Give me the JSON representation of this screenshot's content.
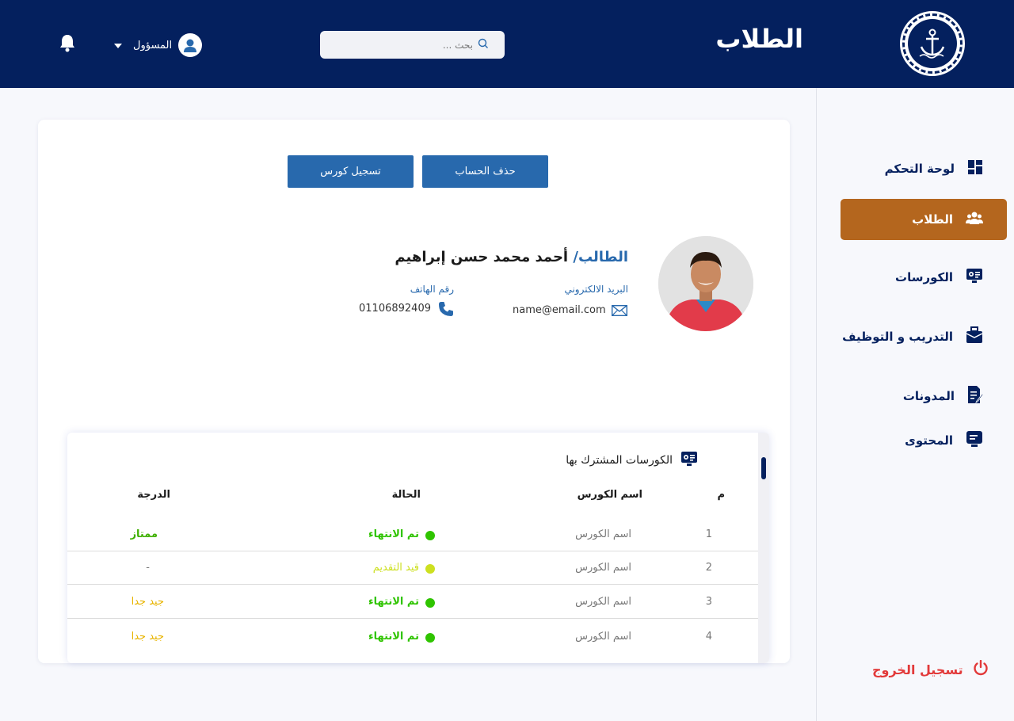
{
  "header": {
    "title": "الطلاب",
    "search_placeholder": "بحث ...",
    "user_label": "المسؤول"
  },
  "sidebar": {
    "items": [
      {
        "label": "لوحة التحكم",
        "icon": "dashboard-icon",
        "active": false
      },
      {
        "label": "الطلاب",
        "icon": "users-icon",
        "active": true
      },
      {
        "label": "الكورسات",
        "icon": "courses-icon",
        "active": false
      },
      {
        "label": "التدريب و التوظيف",
        "icon": "briefcase-icon",
        "active": false
      },
      {
        "label": "المدونات",
        "icon": "blog-edit-icon",
        "active": false
      },
      {
        "label": "المحتوى",
        "icon": "content-icon",
        "active": false
      }
    ],
    "logout_label": "تسجيل الخروج"
  },
  "actions": {
    "delete_account": "حذف الحساب",
    "register_course": "تسجيل كورس"
  },
  "student": {
    "name_prefix": "الطالب/",
    "name": "أحمد محمد حسن إبراهيم",
    "email_label": "البريد الالكتروني",
    "email": "name@email.com",
    "phone_label": "رقم الهاتف",
    "phone": "01106892409"
  },
  "courses": {
    "title": "الكورسات المشترك بها",
    "columns": {
      "num": "م",
      "name": "اسم الكورس",
      "status": "الحالة",
      "grade": "الدرجة"
    },
    "rows": [
      {
        "num": "1",
        "name": "اسم الكورس",
        "status": "تم الانتهاء",
        "grade": "ممتاز"
      },
      {
        "num": "2",
        "name": "اسم الكورس",
        "status": "قيد التقديم",
        "grade": "-"
      },
      {
        "num": "3",
        "name": "اسم الكورس",
        "status": "تم الانتهاء",
        "grade": "جيد جدا"
      },
      {
        "num": "4",
        "name": "اسم الكورس",
        "status": "تم الانتهاء",
        "grade": "جيد جدا"
      }
    ]
  },
  "colors": {
    "navy": "#04205e",
    "accent": "#b4661e",
    "button_blue": "#2869ad",
    "done_green": "#2fc400",
    "pending_yellow": "#cde020",
    "grade_excellent": "#3fb000",
    "grade_very_good": "#e8b400",
    "logout_red": "#e23a3a"
  }
}
